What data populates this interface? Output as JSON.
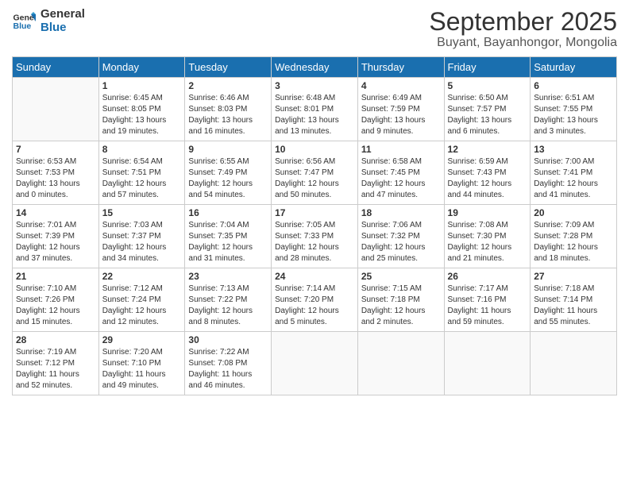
{
  "logo": {
    "line1": "General",
    "line2": "Blue"
  },
  "title": "September 2025",
  "subtitle": "Buyant, Bayanhongor, Mongolia",
  "days_header": [
    "Sunday",
    "Monday",
    "Tuesday",
    "Wednesday",
    "Thursday",
    "Friday",
    "Saturday"
  ],
  "weeks": [
    [
      {
        "num": "",
        "info": ""
      },
      {
        "num": "1",
        "info": "Sunrise: 6:45 AM\nSunset: 8:05 PM\nDaylight: 13 hours\nand 19 minutes."
      },
      {
        "num": "2",
        "info": "Sunrise: 6:46 AM\nSunset: 8:03 PM\nDaylight: 13 hours\nand 16 minutes."
      },
      {
        "num": "3",
        "info": "Sunrise: 6:48 AM\nSunset: 8:01 PM\nDaylight: 13 hours\nand 13 minutes."
      },
      {
        "num": "4",
        "info": "Sunrise: 6:49 AM\nSunset: 7:59 PM\nDaylight: 13 hours\nand 9 minutes."
      },
      {
        "num": "5",
        "info": "Sunrise: 6:50 AM\nSunset: 7:57 PM\nDaylight: 13 hours\nand 6 minutes."
      },
      {
        "num": "6",
        "info": "Sunrise: 6:51 AM\nSunset: 7:55 PM\nDaylight: 13 hours\nand 3 minutes."
      }
    ],
    [
      {
        "num": "7",
        "info": "Sunrise: 6:53 AM\nSunset: 7:53 PM\nDaylight: 13 hours\nand 0 minutes."
      },
      {
        "num": "8",
        "info": "Sunrise: 6:54 AM\nSunset: 7:51 PM\nDaylight: 12 hours\nand 57 minutes."
      },
      {
        "num": "9",
        "info": "Sunrise: 6:55 AM\nSunset: 7:49 PM\nDaylight: 12 hours\nand 54 minutes."
      },
      {
        "num": "10",
        "info": "Sunrise: 6:56 AM\nSunset: 7:47 PM\nDaylight: 12 hours\nand 50 minutes."
      },
      {
        "num": "11",
        "info": "Sunrise: 6:58 AM\nSunset: 7:45 PM\nDaylight: 12 hours\nand 47 minutes."
      },
      {
        "num": "12",
        "info": "Sunrise: 6:59 AM\nSunset: 7:43 PM\nDaylight: 12 hours\nand 44 minutes."
      },
      {
        "num": "13",
        "info": "Sunrise: 7:00 AM\nSunset: 7:41 PM\nDaylight: 12 hours\nand 41 minutes."
      }
    ],
    [
      {
        "num": "14",
        "info": "Sunrise: 7:01 AM\nSunset: 7:39 PM\nDaylight: 12 hours\nand 37 minutes."
      },
      {
        "num": "15",
        "info": "Sunrise: 7:03 AM\nSunset: 7:37 PM\nDaylight: 12 hours\nand 34 minutes."
      },
      {
        "num": "16",
        "info": "Sunrise: 7:04 AM\nSunset: 7:35 PM\nDaylight: 12 hours\nand 31 minutes."
      },
      {
        "num": "17",
        "info": "Sunrise: 7:05 AM\nSunset: 7:33 PM\nDaylight: 12 hours\nand 28 minutes."
      },
      {
        "num": "18",
        "info": "Sunrise: 7:06 AM\nSunset: 7:32 PM\nDaylight: 12 hours\nand 25 minutes."
      },
      {
        "num": "19",
        "info": "Sunrise: 7:08 AM\nSunset: 7:30 PM\nDaylight: 12 hours\nand 21 minutes."
      },
      {
        "num": "20",
        "info": "Sunrise: 7:09 AM\nSunset: 7:28 PM\nDaylight: 12 hours\nand 18 minutes."
      }
    ],
    [
      {
        "num": "21",
        "info": "Sunrise: 7:10 AM\nSunset: 7:26 PM\nDaylight: 12 hours\nand 15 minutes."
      },
      {
        "num": "22",
        "info": "Sunrise: 7:12 AM\nSunset: 7:24 PM\nDaylight: 12 hours\nand 12 minutes."
      },
      {
        "num": "23",
        "info": "Sunrise: 7:13 AM\nSunset: 7:22 PM\nDaylight: 12 hours\nand 8 minutes."
      },
      {
        "num": "24",
        "info": "Sunrise: 7:14 AM\nSunset: 7:20 PM\nDaylight: 12 hours\nand 5 minutes."
      },
      {
        "num": "25",
        "info": "Sunrise: 7:15 AM\nSunset: 7:18 PM\nDaylight: 12 hours\nand 2 minutes."
      },
      {
        "num": "26",
        "info": "Sunrise: 7:17 AM\nSunset: 7:16 PM\nDaylight: 11 hours\nand 59 minutes."
      },
      {
        "num": "27",
        "info": "Sunrise: 7:18 AM\nSunset: 7:14 PM\nDaylight: 11 hours\nand 55 minutes."
      }
    ],
    [
      {
        "num": "28",
        "info": "Sunrise: 7:19 AM\nSunset: 7:12 PM\nDaylight: 11 hours\nand 52 minutes."
      },
      {
        "num": "29",
        "info": "Sunrise: 7:20 AM\nSunset: 7:10 PM\nDaylight: 11 hours\nand 49 minutes."
      },
      {
        "num": "30",
        "info": "Sunrise: 7:22 AM\nSunset: 7:08 PM\nDaylight: 11 hours\nand 46 minutes."
      },
      {
        "num": "",
        "info": ""
      },
      {
        "num": "",
        "info": ""
      },
      {
        "num": "",
        "info": ""
      },
      {
        "num": "",
        "info": ""
      }
    ]
  ]
}
